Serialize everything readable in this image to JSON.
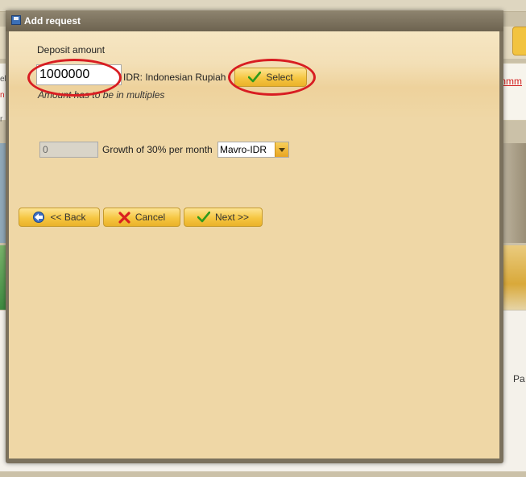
{
  "background": {
    "red_link_text": "mmm",
    "side_text": "Pa",
    "left_edge_texts": [
      "eb",
      "n",
      "r"
    ]
  },
  "dialog": {
    "title": "Add request",
    "deposit_label": "Deposit amount",
    "amount_value": "1000000",
    "currency_label": "IDR: Indonesian Rupiah",
    "select_button": "Select",
    "hint": "Amount has to be in multiples",
    "growth_value": "0",
    "growth_label": "Growth of 30% per month",
    "plan_select": "Mavro-IDR",
    "back_button": "<< Back",
    "cancel_button": "Cancel",
    "next_button": "Next >>"
  },
  "colors": {
    "annotation_red": "#d81d22",
    "button_gold": "#f6c641",
    "dialog_bg": "#efd7a6",
    "titlebar": "#7b715d"
  },
  "icons": {
    "title": "save-icon",
    "select": "checkmark-icon",
    "back": "arrow-left-icon",
    "cancel": "red-x-icon",
    "next": "checkmark-icon"
  }
}
